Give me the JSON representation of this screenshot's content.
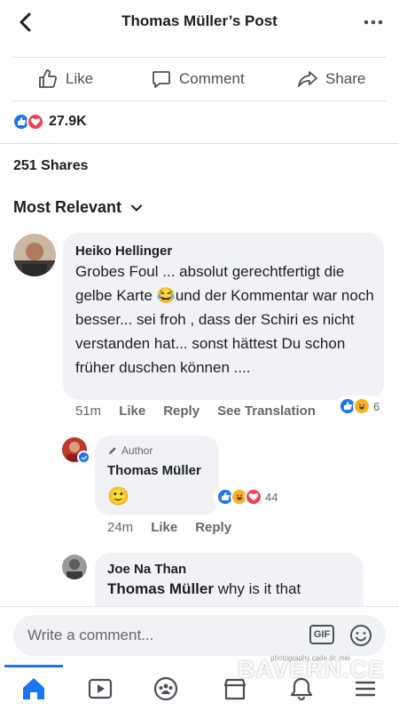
{
  "header": {
    "title": "Thomas Müller’s Post"
  },
  "actions": {
    "like": "Like",
    "comment": "Comment",
    "share": "Share"
  },
  "reactions": {
    "count": "27.9K"
  },
  "shares": "251 Shares",
  "sort": {
    "label": "Most Relevant"
  },
  "comments": [
    {
      "name": "Heiko Hellinger",
      "text": "Grobes Foul ... absolut gerechtfertigt die gelbe Karte 😂und der Kommentar war noch besser... sei froh , dass der Schiri es nicht verstanden hat... sonst hättest Du schon früher duschen können ....",
      "time": "51m",
      "like": "Like",
      "reply": "Reply",
      "see_translation": "See Translation",
      "reaction_count": "6"
    },
    {
      "author_tag": "Author",
      "name": "Thomas Müller",
      "text": "🙂",
      "time": "24m",
      "like": "Like",
      "reply": "Reply",
      "reaction_count": "44"
    },
    {
      "name": "Joe Na Than",
      "mention": "Thomas Müller",
      "text": "why is it that"
    }
  ],
  "composer": {
    "placeholder": "Write a comment...",
    "gif": "GIF"
  },
  "watermark": "BAVERN.CE",
  "watermark_small": "photography cade dc mei",
  "colors": {
    "accent": "#1877f2",
    "love": "#f33e58",
    "haha": "#f7b125",
    "bubble": "#f0f2f5"
  }
}
